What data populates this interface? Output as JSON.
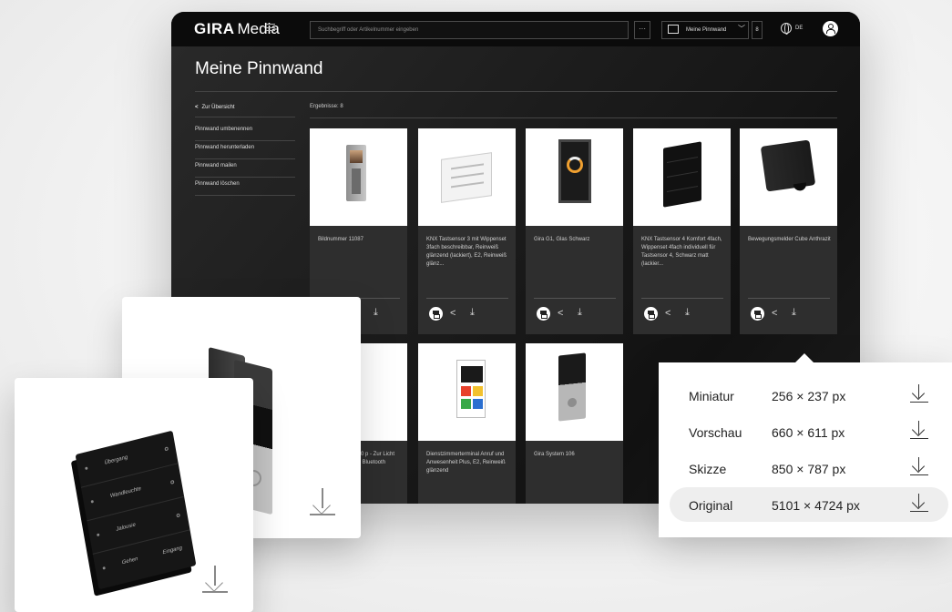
{
  "app": {
    "brand": "GIRA",
    "product": "Media",
    "search_placeholder": "Suchbegriff oder Artikelnummer eingeben",
    "more_label": "···",
    "board_select": "Meine Pinnwand",
    "board_count": "8",
    "language": "DE"
  },
  "page": {
    "title": "Meine Pinnwand",
    "back_label": "Zur Übersicht",
    "results_label": "Ergebnisse: 8"
  },
  "sidebar": {
    "items": [
      {
        "label": "Pinnwand umbenennen"
      },
      {
        "label": "Pinnwand herunterladen"
      },
      {
        "label": "Pinnwand mailen"
      },
      {
        "label": "Pinnwand löschen"
      }
    ]
  },
  "cards": [
    {
      "name": "Bildnummer 11087"
    },
    {
      "name": "KNX Tastsensor 3 mit Wippenset 3fach beschreibbar, Reinweiß glänzend (lackiert), E2, Reinweiß glänz..."
    },
    {
      "name": "Gira G1, Glas Schwarz"
    },
    {
      "name": "KNX Tastsensor 4 Komfort 4fach, Wippenset 4fach individuell für Tastsensor 4, Schwarz matt (lackier..."
    },
    {
      "name": "Bewegungsmelder Cube Anthrazit"
    },
    {
      "name": "3000 p - Zur Licht und Bluetooth"
    },
    {
      "name": "Dienstzimmerterminal Anruf und Anwesenheit Plus, E2, Reinweiß glänzend"
    },
    {
      "name": "Gira System 106"
    }
  ],
  "keypad_labels": [
    "Übergang",
    "Wandleuchte",
    "Jalousie",
    "Gehen"
  ],
  "keypad_right_labels": [
    "",
    "",
    "",
    "Eingang"
  ],
  "sizes": [
    {
      "name": "Miniatur",
      "dims": "256 × 237 px",
      "active": false
    },
    {
      "name": "Vorschau",
      "dims": "660 × 611 px",
      "active": false
    },
    {
      "name": "Skizze",
      "dims": "850 × 787 px",
      "active": false
    },
    {
      "name": "Original",
      "dims": "5101 × 4724 px",
      "active": true
    }
  ],
  "icons": {
    "menu": "hamburger-icon",
    "add_board": "add-to-board-icon",
    "globe": "globe-icon",
    "user": "user-icon",
    "print": "print-icon",
    "share": "share-icon",
    "download": "download-icon"
  }
}
